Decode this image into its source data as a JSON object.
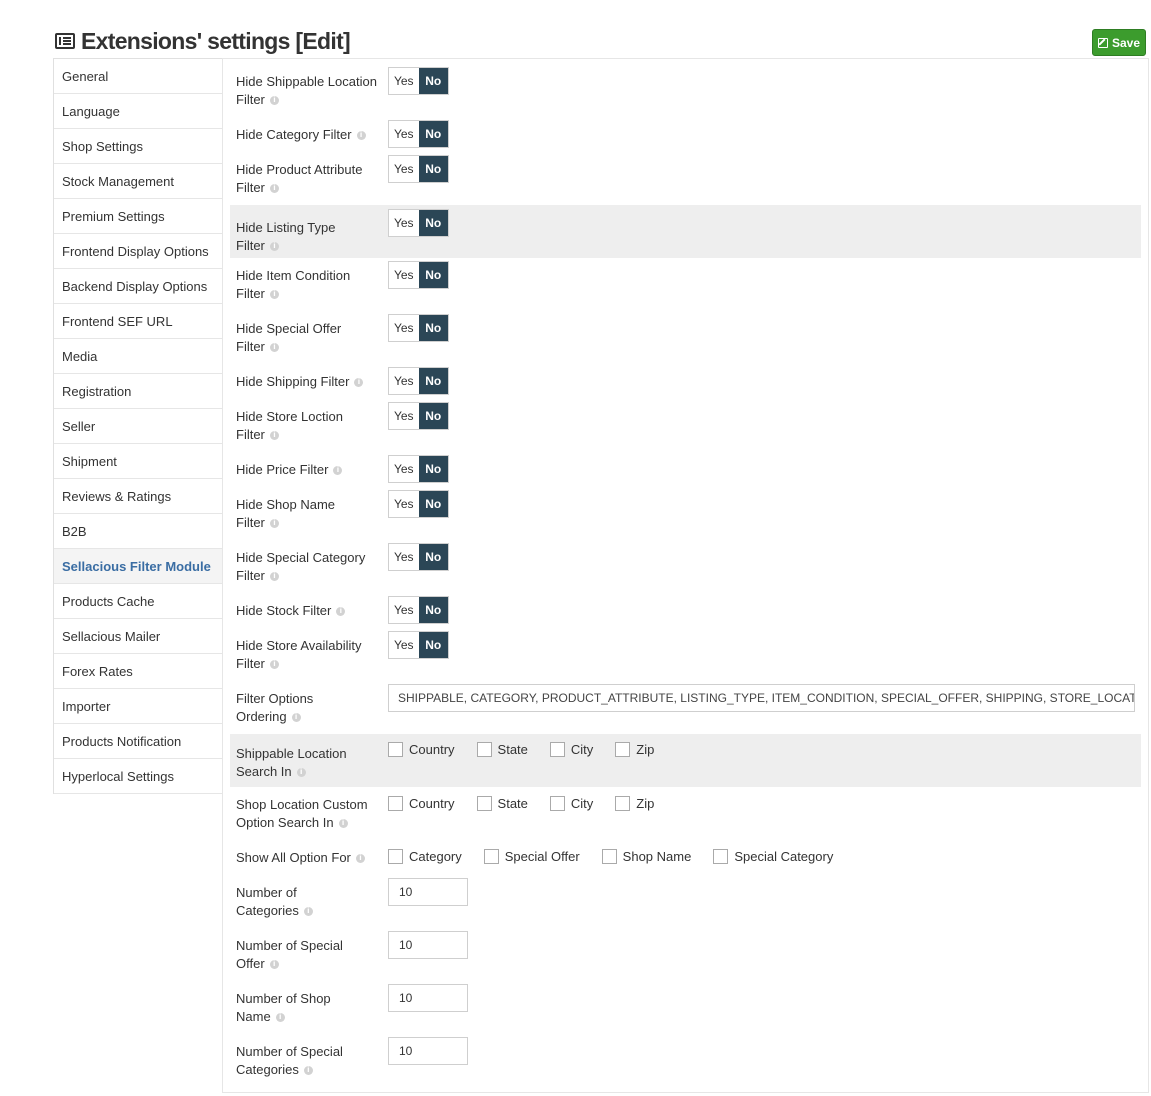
{
  "header": {
    "title": "Extensions' settings [Edit]",
    "save_label": "Save"
  },
  "sidebar": {
    "items": [
      {
        "label": "General"
      },
      {
        "label": "Language"
      },
      {
        "label": "Shop Settings"
      },
      {
        "label": "Stock Management"
      },
      {
        "label": "Premium Settings"
      },
      {
        "label": "Frontend Display Options"
      },
      {
        "label": "Backend Display Options"
      },
      {
        "label": "Frontend SEF URL"
      },
      {
        "label": "Media"
      },
      {
        "label": "Registration"
      },
      {
        "label": "Seller"
      },
      {
        "label": "Shipment"
      },
      {
        "label": "Reviews & Ratings"
      },
      {
        "label": "B2B"
      },
      {
        "label": "Sellacious Filter Module"
      },
      {
        "label": "Products Cache"
      },
      {
        "label": "Sellacious Mailer"
      },
      {
        "label": "Forex Rates"
      },
      {
        "label": "Importer"
      },
      {
        "label": "Products Notification"
      },
      {
        "label": "Hyperlocal Settings"
      }
    ],
    "active_index": 14
  },
  "toggle_labels": {
    "yes": "Yes",
    "no": "No"
  },
  "toggles": [
    {
      "l1": "Hide Shippable Location",
      "l2": "Filter",
      "value": "No"
    },
    {
      "l1": "Hide Category Filter",
      "l2": "",
      "value": "No"
    },
    {
      "l1": "Hide Product Attribute",
      "l2": "Filter",
      "value": "No"
    },
    {
      "l1": "Hide Listing Type",
      "l2": "Filter",
      "value": "No"
    },
    {
      "l1": "Hide Item Condition",
      "l2": "Filter",
      "value": "No"
    },
    {
      "l1": "Hide Special Offer",
      "l2": "Filter",
      "value": "No"
    },
    {
      "l1": "Hide Shipping Filter",
      "l2": "",
      "value": "No"
    },
    {
      "l1": "Hide Store Loction",
      "l2": "Filter",
      "value": "No"
    },
    {
      "l1": "Hide Price Filter",
      "l2": "",
      "value": "No"
    },
    {
      "l1": "Hide Shop Name",
      "l2": "Filter",
      "value": "No"
    },
    {
      "l1": "Hide Special Category",
      "l2": "Filter",
      "value": "No"
    },
    {
      "l1": "Hide Stock Filter",
      "l2": "",
      "value": "No"
    },
    {
      "l1": "Hide Store Availability",
      "l2": "Filter",
      "value": "No"
    }
  ],
  "ordering": {
    "l1": "Filter Options",
    "l2": "Ordering",
    "value": "SHIPPABLE, CATEGORY, PRODUCT_ATTRIBUTE, LISTING_TYPE, ITEM_CONDITION, SPECIAL_OFFER, SHIPPING, STORE_LOCATION, SHOP_NAME, PRICE, SPECIAL_CATEGORY, STOCK, STORE_AVAILABILITY"
  },
  "checkgroups": [
    {
      "l1": "Shippable Location",
      "l2": "Search In",
      "options": [
        "Country",
        "State",
        "City",
        "Zip"
      ]
    },
    {
      "l1": "Shop Location Custom",
      "l2": "Option Search In",
      "options": [
        "Country",
        "State",
        "City",
        "Zip"
      ]
    },
    {
      "l1": "Show All Option For",
      "l2": "",
      "options": [
        "Category",
        "Special Offer",
        "Shop Name",
        "Special Category"
      ]
    }
  ],
  "numbers": [
    {
      "l1": "Number of",
      "l2": "Categories",
      "value": "10"
    },
    {
      "l1": "Number of Special",
      "l2": "Offer",
      "value": "10"
    },
    {
      "l1": "Number of Shop",
      "l2": "Name",
      "value": "10"
    },
    {
      "l1": "Number of Special",
      "l2": "Categories",
      "value": "10"
    }
  ]
}
